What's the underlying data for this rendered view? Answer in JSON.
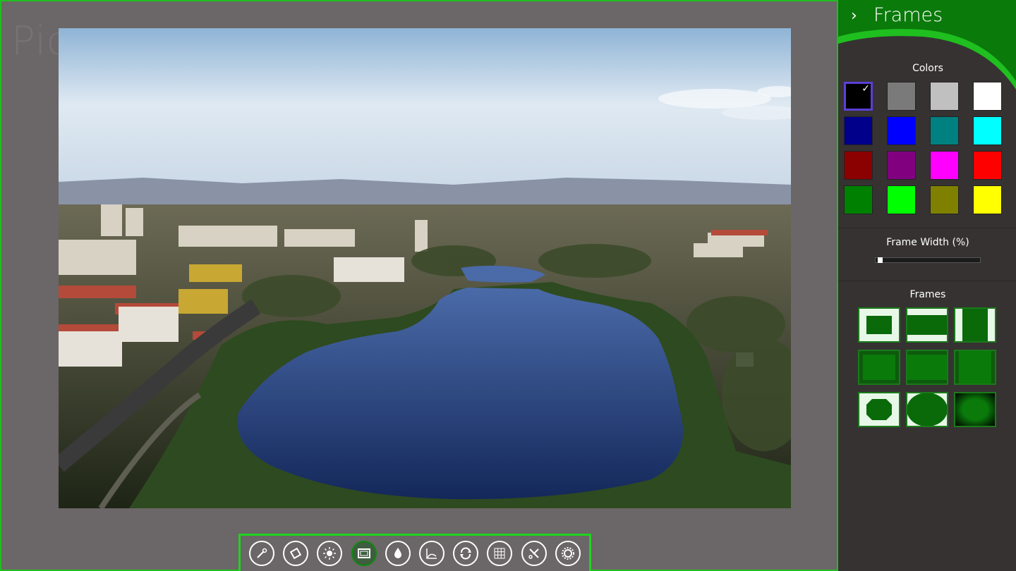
{
  "app": {
    "background_title": "Pic"
  },
  "panel": {
    "title": "Frames",
    "back_icon": "chevron-right-icon",
    "colors_label": "Colors",
    "swatches": [
      {
        "color": "#000000",
        "selected": true
      },
      {
        "color": "#7a7a7a",
        "selected": false
      },
      {
        "color": "#c0c0c0",
        "selected": false
      },
      {
        "color": "#ffffff",
        "selected": false
      },
      {
        "color": "#00008b",
        "selected": false
      },
      {
        "color": "#0000ff",
        "selected": false
      },
      {
        "color": "#008080",
        "selected": false
      },
      {
        "color": "#00ffff",
        "selected": false
      },
      {
        "color": "#8b0000",
        "selected": false
      },
      {
        "color": "#800080",
        "selected": false
      },
      {
        "color": "#ff00ff",
        "selected": false
      },
      {
        "color": "#ff0000",
        "selected": false
      },
      {
        "color": "#008000",
        "selected": false
      },
      {
        "color": "#00ff00",
        "selected": false
      },
      {
        "color": "#808000",
        "selected": false
      },
      {
        "color": "#ffff00",
        "selected": false
      }
    ],
    "frame_width_label": "Frame Width (%)",
    "frame_width_value": 0.03,
    "frames_label": "Frames",
    "frame_styles": [
      "full-border",
      "top-bottom-bars",
      "side-bars",
      "thin-border",
      "thin-top-bottom",
      "thin-sides",
      "octagon",
      "circle",
      "vignette"
    ]
  },
  "toolbar": {
    "tools": [
      {
        "name": "magic-wand-icon",
        "active": false
      },
      {
        "name": "crop-rotate-icon",
        "active": false
      },
      {
        "name": "brightness-icon",
        "active": false
      },
      {
        "name": "frame-icon",
        "active": true
      },
      {
        "name": "color-drop-icon",
        "active": false
      },
      {
        "name": "curves-icon",
        "active": false
      },
      {
        "name": "rotate-icon",
        "active": false
      },
      {
        "name": "grid-icon",
        "active": false
      },
      {
        "name": "tools-icon",
        "active": false
      },
      {
        "name": "settings-gear-icon",
        "active": false
      }
    ]
  },
  "colors": {
    "accent": "#1fbf1f",
    "panel_bg": "#363232",
    "canvas_bg": "#6b6667"
  }
}
